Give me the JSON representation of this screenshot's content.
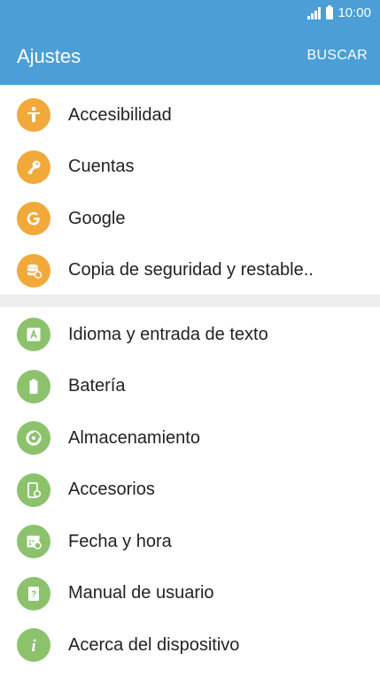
{
  "status_bar": {
    "time": "10:00",
    "icons": [
      "signal-icon",
      "battery-icon"
    ]
  },
  "header": {
    "title": "Ajustes",
    "action_label": "BUSCAR"
  },
  "colors": {
    "header_bg": "#4b9fd6",
    "icon_orange": "#f2a93b",
    "icon_green": "#8cc26c",
    "separator": "#eeeeee"
  },
  "groups": [
    {
      "items": [
        {
          "label": "Accesibilidad",
          "icon": "accessibility-icon",
          "color": "orange"
        },
        {
          "label": "Cuentas",
          "icon": "key-icon",
          "color": "orange"
        },
        {
          "label": "Google",
          "icon": "google-icon",
          "color": "orange"
        },
        {
          "label": "Copia de seguridad y restable..",
          "icon": "backup-restore-icon",
          "color": "orange"
        }
      ]
    },
    {
      "items": [
        {
          "label": "Idioma y entrada de texto",
          "icon": "language-input-icon",
          "color": "green"
        },
        {
          "label": "Batería",
          "icon": "battery-icon",
          "color": "green"
        },
        {
          "label": "Almacenamiento",
          "icon": "storage-icon",
          "color": "green"
        },
        {
          "label": "Accesorios",
          "icon": "accessories-icon",
          "color": "green"
        },
        {
          "label": "Fecha y hora",
          "icon": "calendar-clock-icon",
          "color": "green"
        },
        {
          "label": "Manual de usuario",
          "icon": "user-manual-icon",
          "color": "green"
        },
        {
          "label": "Acerca del dispositivo",
          "icon": "info-icon",
          "color": "green"
        }
      ]
    }
  ]
}
